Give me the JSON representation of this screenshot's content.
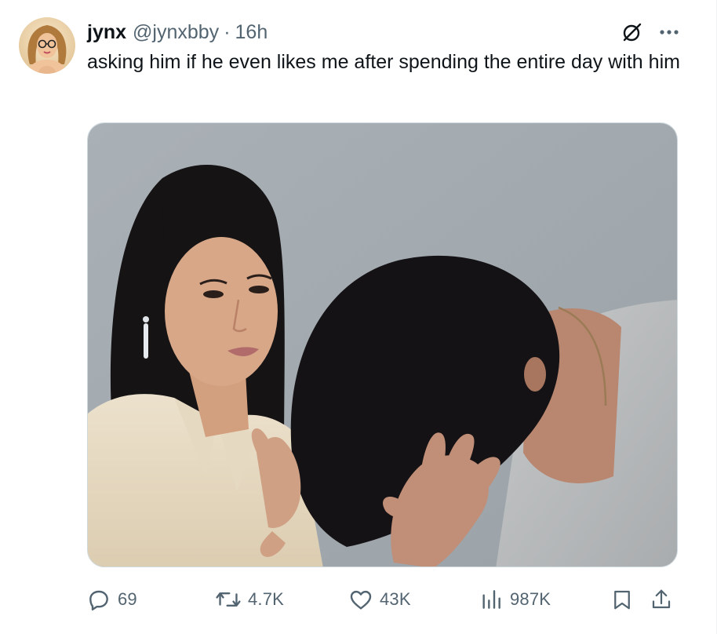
{
  "tweet": {
    "display_name": "jynx",
    "handle": "@jynxbby",
    "separator": "·",
    "time": "16h",
    "text": "asking him if he even likes me after spending the entire day with him"
  },
  "actions": {
    "replies": "69",
    "reposts": "4.7K",
    "likes": "43K",
    "views": "987K"
  },
  "icons": {
    "grok": "grok-icon",
    "more": "more-icon",
    "reply": "reply-icon",
    "repost": "repost-icon",
    "like": "heart-icon",
    "views": "views-icon",
    "bookmark": "bookmark-icon",
    "share": "share-icon"
  },
  "colors": {
    "text": "#0f1419",
    "secondary": "#536471",
    "border": "#cfd9de"
  }
}
